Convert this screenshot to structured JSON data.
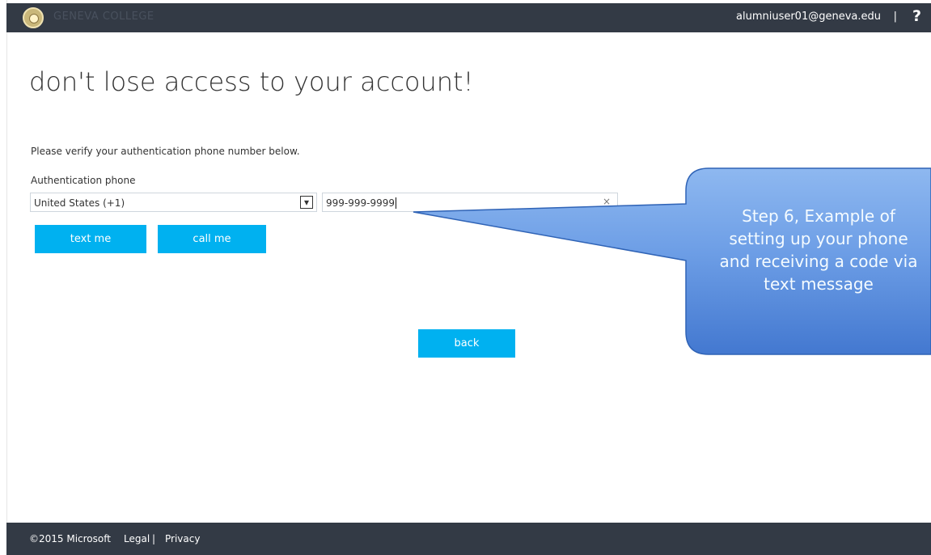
{
  "header": {
    "org_name": "GENEVA COLLEGE",
    "user_email": "alumniuser01@geneva.edu",
    "separator": "|",
    "help_label": "?"
  },
  "main": {
    "title": "don't lose access to your account!",
    "description": "Please verify your authentication phone number below.",
    "phone_label": "Authentication phone",
    "country_value": "United States (+1)",
    "phone_value": "999-999-9999",
    "clear_label": "×",
    "text_me": "text me",
    "call_me": "call me",
    "back": "back"
  },
  "callout": {
    "line1": "Step 6, Example of",
    "line2": "setting up your phone",
    "line3": "and receiving a code via",
    "line4": "text message"
  },
  "footer": {
    "copyright": "©2015 Microsoft",
    "legal": "Legal",
    "separator": "|",
    "privacy": "Privacy"
  },
  "icons": {
    "dropdown": "chevron-down-icon",
    "clear": "close-icon",
    "logo": "college-seal-icon"
  },
  "colors": {
    "header_bg": "#333a45",
    "button_bg": "#00b1f0",
    "callout_fill": "#6f9fe4"
  }
}
